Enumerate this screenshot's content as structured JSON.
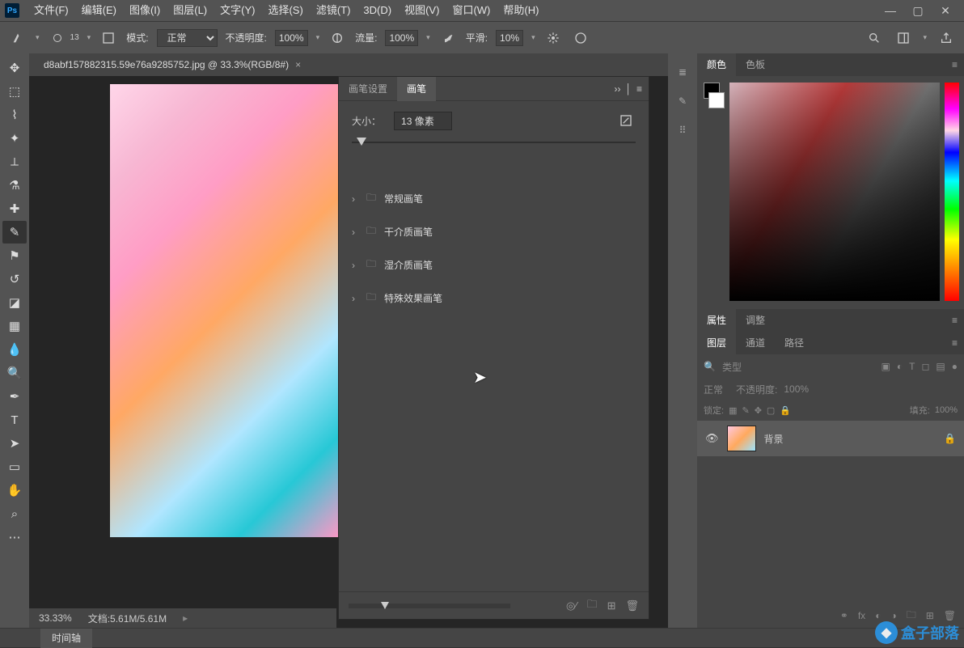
{
  "menubar": {
    "items": [
      "文件(F)",
      "编辑(E)",
      "图像(I)",
      "图层(L)",
      "文字(Y)",
      "选择(S)",
      "滤镜(T)",
      "3D(D)",
      "视图(V)",
      "窗口(W)",
      "帮助(H)"
    ]
  },
  "options_bar": {
    "brush_size_display": "13",
    "mode_label": "模式:",
    "mode_value": "正常",
    "opacity_label": "不透明度:",
    "opacity_value": "100%",
    "flow_label": "流量:",
    "flow_value": "100%",
    "smoothing_label": "平滑:",
    "smoothing_value": "10%"
  },
  "document": {
    "tab_title": "d8abf157882315.59e76a9285752.jpg @ 33.3%(RGB/8#)",
    "zoom": "33.33%",
    "docinfo_label": "文档:",
    "docinfo_value": "5.61M/5.61M"
  },
  "timeline": {
    "tab": "时间轴"
  },
  "brush_panel": {
    "tab_settings": "画笔设置",
    "tab_brush": "画笔",
    "size_label": "大小：",
    "size_value": "13 像素",
    "folders": [
      "常规画笔",
      "干介质画笔",
      "湿介质画笔",
      "特殊效果画笔"
    ]
  },
  "right_panels": {
    "color_tab": "颜色",
    "swatches_tab": "色板",
    "properties_tab": "属性",
    "adjustments_tab": "调整",
    "layers_tab": "图层",
    "channels_tab": "通道",
    "paths_tab": "路径"
  },
  "layers_panel": {
    "filter_placeholder": "类型",
    "blend_mode": "正常",
    "opacity_label": "不透明度:",
    "opacity_value": "100%",
    "lock_label": "锁定:",
    "fill_label": "填充:",
    "fill_value": "100%",
    "layer_name": "背景"
  },
  "watermark": {
    "text": "盒子部落"
  }
}
